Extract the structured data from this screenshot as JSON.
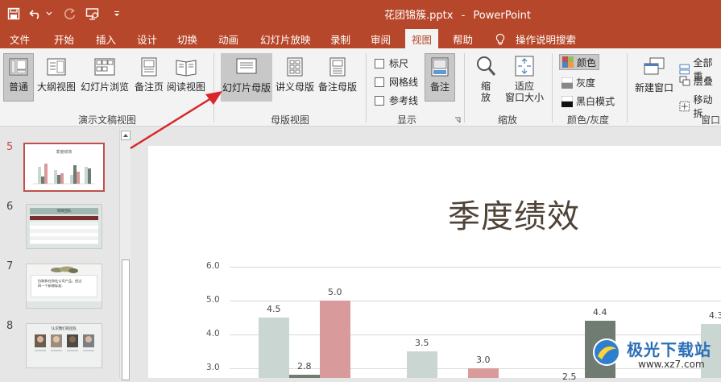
{
  "app": {
    "document": "花团锦簇.pptx",
    "separator": "-",
    "name": "PowerPoint"
  },
  "qat": {
    "icons": [
      "save-icon",
      "undo-icon",
      "redo-icon",
      "start-from-beginning-icon",
      "customize-qat-icon"
    ]
  },
  "tabs": [
    "文件",
    "开始",
    "插入",
    "设计",
    "切换",
    "动画",
    "幻灯片放映",
    "录制",
    "审阅",
    "视图",
    "帮助",
    "操作说明搜索"
  ],
  "active_tab": "视图",
  "ribbon": {
    "presentation_views": {
      "group_label": "演示文稿视图",
      "buttons": [
        "普通",
        "大纲视图",
        "幻灯片浏览",
        "备注页",
        "阅读视图"
      ]
    },
    "master_views": {
      "group_label": "母版视图",
      "buttons": [
        "幻灯片母版",
        "讲义母版",
        "备注母版"
      ]
    },
    "show": {
      "group_label": "显示",
      "checkboxes": [
        "标尺",
        "网格线",
        "参考线"
      ],
      "notes_button": "备注"
    },
    "zoom": {
      "group_label": "缩放",
      "zoom_button_line1": "缩",
      "zoom_button_line2": "放",
      "fit_button_line1": "适应",
      "fit_button_line2": "窗口大小"
    },
    "color": {
      "group_label": "颜色/灰度",
      "options": [
        "颜色",
        "灰度",
        "黑白模式"
      ]
    },
    "window": {
      "group_label": "窗口",
      "new_window": "新建窗口",
      "items": [
        "全部重",
        "层叠",
        "移动拆"
      ]
    }
  },
  "slides": {
    "numbers": [
      "5",
      "6",
      "7",
      "8"
    ],
    "selected": "5",
    "thumb5_title": "季度绩效",
    "thumb6_title": "项目团队",
    "thumb7_text1": "拉取和在和社公司产品，经过",
    "thumb7_text2": "四一个新增标准.",
    "thumb8_title": "认识我们的团队"
  },
  "slide": {
    "title": "季度绩效"
  },
  "chart_data": {
    "type": "bar",
    "yticks": [
      "6.0",
      "5.0",
      "4.0",
      "3.0"
    ],
    "ylim": [
      2.7,
      6.0
    ],
    "categories": [
      "",
      "",
      "",
      ""
    ],
    "series": [
      {
        "values": [
          4.5,
          3.5,
          2.5,
          4.3
        ],
        "color": "#c9d6d2"
      },
      {
        "values": [
          2.8,
          null,
          4.4,
          null
        ],
        "color": "#707b72"
      },
      {
        "values": [
          5.0,
          3.0,
          null,
          null
        ],
        "color": "#d89a9a"
      }
    ],
    "data_labels": [
      "4.5",
      "2.8",
      "5.0",
      "3.5",
      "3.0",
      "2.5",
      "4.4",
      "4.3"
    ],
    "grid": true
  },
  "watermark": {
    "text1": "极光下载站",
    "text2": "www.xz7.com"
  }
}
